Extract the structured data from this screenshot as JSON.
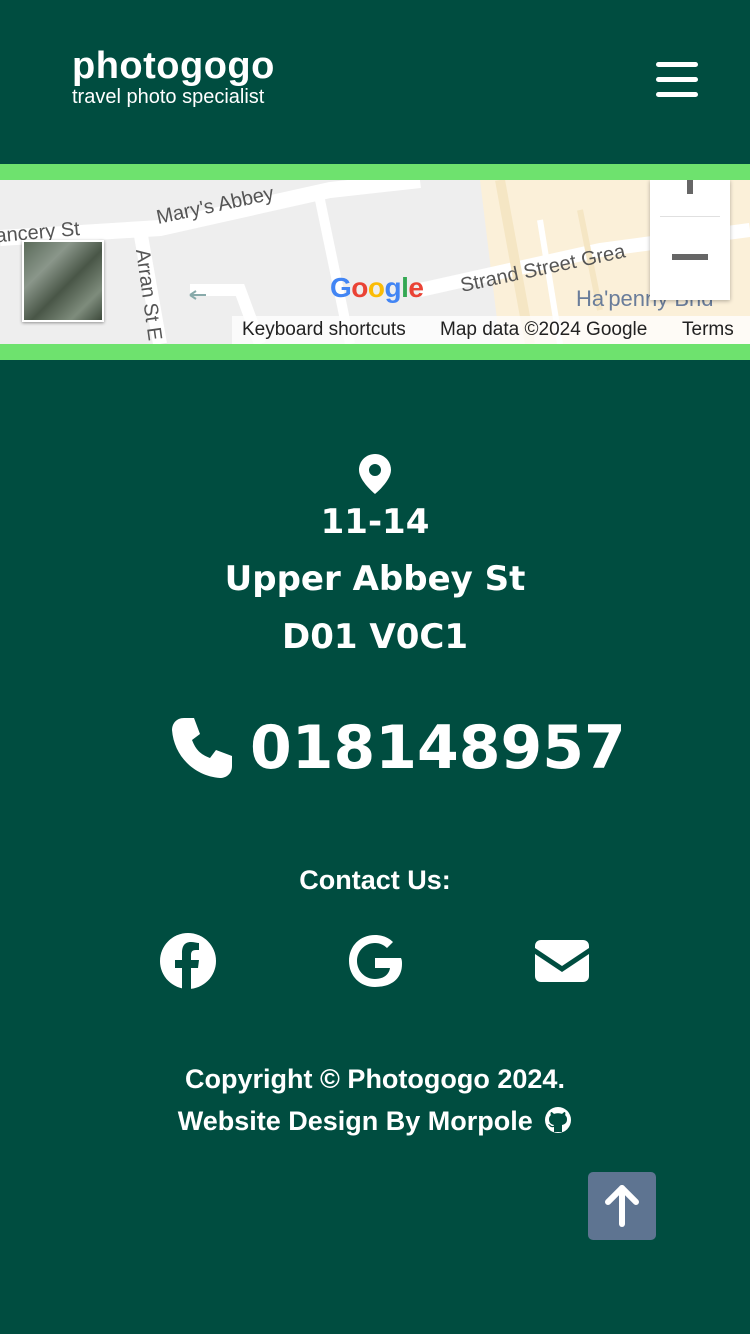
{
  "header": {
    "brand_name": "photogogo",
    "tagline": "travel photo specialist",
    "menu_icon": "hamburger-icon"
  },
  "map": {
    "streets": [
      "Mary's Abbey",
      "ancery St",
      "Arran St E",
      "Strand Street Grea",
      "Ha'penny Brid"
    ],
    "logo": "Google",
    "footer": {
      "shortcuts": "Keyboard shortcuts",
      "map_data": "Map data ©2024 Google",
      "terms": "Terms"
    }
  },
  "address": {
    "icon": "location-pin-icon",
    "line1": "11-14",
    "line2": "Upper Abbey St",
    "line3": "D01 V0C1"
  },
  "phone": {
    "icon": "phone-icon",
    "number": "018148957"
  },
  "contact": {
    "label": "Contact Us:",
    "links": [
      "facebook-icon",
      "google-icon",
      "envelope-icon"
    ]
  },
  "footer": {
    "copyright": "Copyright © Photogogo 2024.",
    "design": "Website Design By Morpole",
    "design_icon": "github-icon"
  },
  "back_to_top_icon": "arrow-up-icon",
  "colors": {
    "background": "#004d40",
    "accent_border": "#6ee26e",
    "top_button": "#5e7491"
  }
}
